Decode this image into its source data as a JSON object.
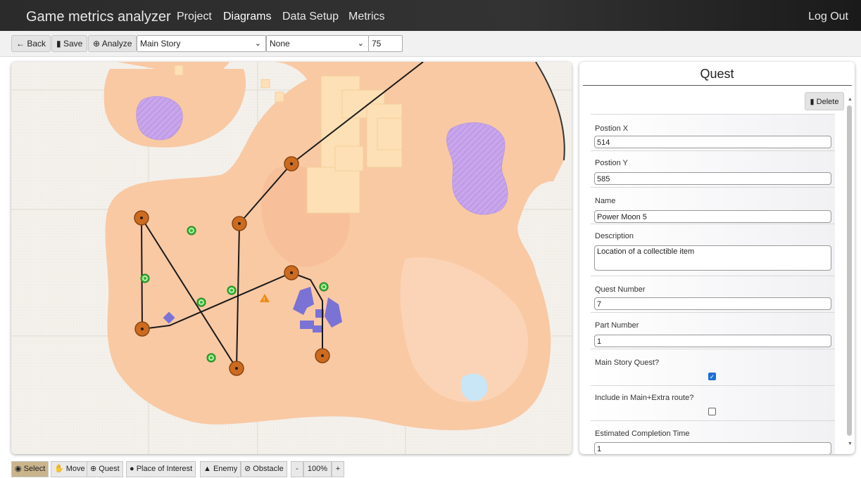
{
  "nav": {
    "brand": "Game metrics analyzer",
    "links": [
      "Project",
      "Diagrams",
      "Data Setup",
      "Metrics"
    ],
    "active": "Diagrams",
    "logout": "Log Out"
  },
  "toolbar": {
    "back": "Back",
    "save": "Save",
    "analyze": "Analyze",
    "route_select": "Main Story",
    "filter_select": "None",
    "value_input": "75"
  },
  "panel": {
    "title": "Quest",
    "delete": "Delete",
    "fields": {
      "pos_x_label": "Postion X",
      "pos_x": "514",
      "pos_y_label": "Postion Y",
      "pos_y": "585",
      "name_label": "Name",
      "name": "Power Moon 5",
      "desc_label": "Description",
      "desc": "Location of a collectible item",
      "quest_num_label": "Quest Number",
      "quest_num": "7",
      "part_num_label": "Part Number",
      "part_num": "1",
      "main_story_label": "Main Story Quest?",
      "main_story_checked": true,
      "include_label": "Include in Main+Extra route?",
      "include_checked": false,
      "est_time_label": "Estimated Completion Time",
      "est_time": "1"
    }
  },
  "bottombar": {
    "select": "Select",
    "move": "Move",
    "quest": "Quest",
    "poi": "Place of Interest",
    "enemy": "Enemy",
    "obstacle": "Obstacle",
    "zoom_out": "-",
    "zoom": "100%",
    "zoom_in": "+"
  },
  "colors": {
    "land": "#f9c9a4",
    "quest_node": "#cc6b1f",
    "poi_marker": "#3bbb34",
    "water": "#c8a8e6",
    "route_line": "#1a1a1a"
  }
}
